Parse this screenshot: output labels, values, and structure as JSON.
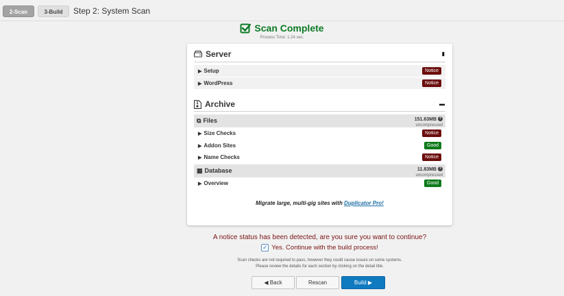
{
  "steps": [
    {
      "label": "2-Scan",
      "active": true
    },
    {
      "label": "3-Build",
      "active": false
    }
  ],
  "step_title": "Step 2: System Scan",
  "header": {
    "title": "Scan Complete",
    "process_time": "Process Time: 1.24 sec."
  },
  "server": {
    "title": "Server",
    "rows": [
      {
        "label": "Setup",
        "status": "Notice"
      },
      {
        "label": "WordPress",
        "status": "Notice"
      }
    ]
  },
  "archive": {
    "title": "Archive",
    "files": {
      "title": "Files",
      "size": "151.63MB",
      "size_note": "uncompressed",
      "rows": [
        {
          "label": "Size Checks",
          "status": "Notice"
        },
        {
          "label": "Addon Sites",
          "status": "Good"
        },
        {
          "label": "Name Checks",
          "status": "Notice"
        }
      ]
    },
    "database": {
      "title": "Database",
      "size": "11.83MB",
      "size_note": "uncompressed",
      "rows": [
        {
          "label": "Overview",
          "status": "Good"
        }
      ]
    }
  },
  "promo": {
    "text": "Migrate large, multi-gig sites with",
    "link": "Duplicator Pro!"
  },
  "notice_message": "A notice status has been detected, are you sure you want to continue?",
  "continue_label": "Yes. Continue with the build process!",
  "note_line1": "Scan checks are not required to pass, however they could cause issues on some systems.",
  "note_line2": "Please review the details for each section by clicking on the detail title.",
  "buttons": {
    "back": "◀ Back",
    "rescan": "Rescan",
    "build": "Build ▶"
  },
  "colors": {
    "success": "#0c7a24",
    "notice": "#6b0c0c",
    "good": "#0d7a1b",
    "primary": "#0f7ac0",
    "warning_text": "#7a1212"
  }
}
